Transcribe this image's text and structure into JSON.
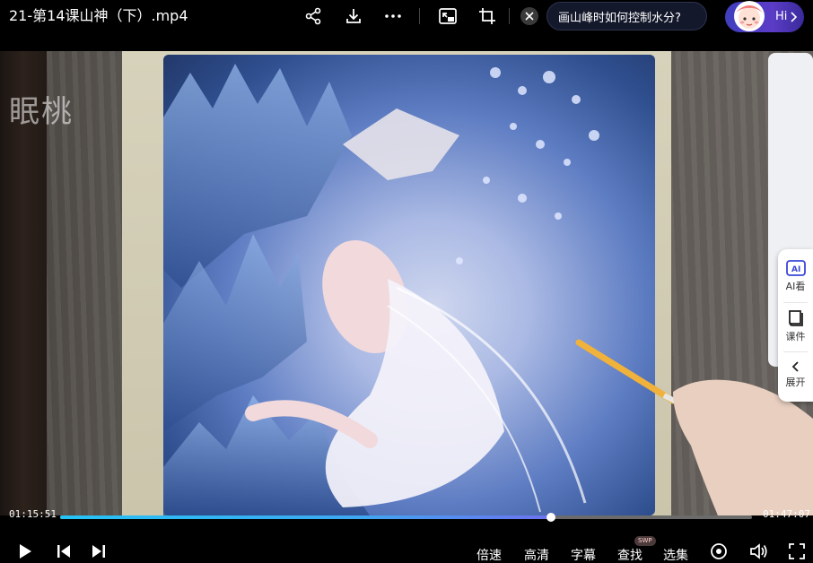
{
  "header": {
    "title": "21-第14课山神（下）.mp4",
    "icons": [
      "share-icon",
      "download-icon",
      "more-icon",
      "picture-in-picture-icon",
      "crop-icon",
      "close-icon"
    ],
    "question": "画山峰时如何控制水分?",
    "assistant_label": "Hi"
  },
  "video": {
    "watermark": "眠桃"
  },
  "side_panel": {
    "ai_label": "AI看",
    "courseware_label": "课件",
    "expand_label": "展开"
  },
  "player": {
    "current_time": "01:15:51",
    "total_time": "01:47:07",
    "progress": 0.71,
    "controls": {
      "speed": "倍速",
      "quality": "高清",
      "subtitle": "字幕",
      "search": "查找",
      "search_badge": "SWP",
      "episodes": "选集"
    },
    "accent_color": "#25c3f5"
  }
}
